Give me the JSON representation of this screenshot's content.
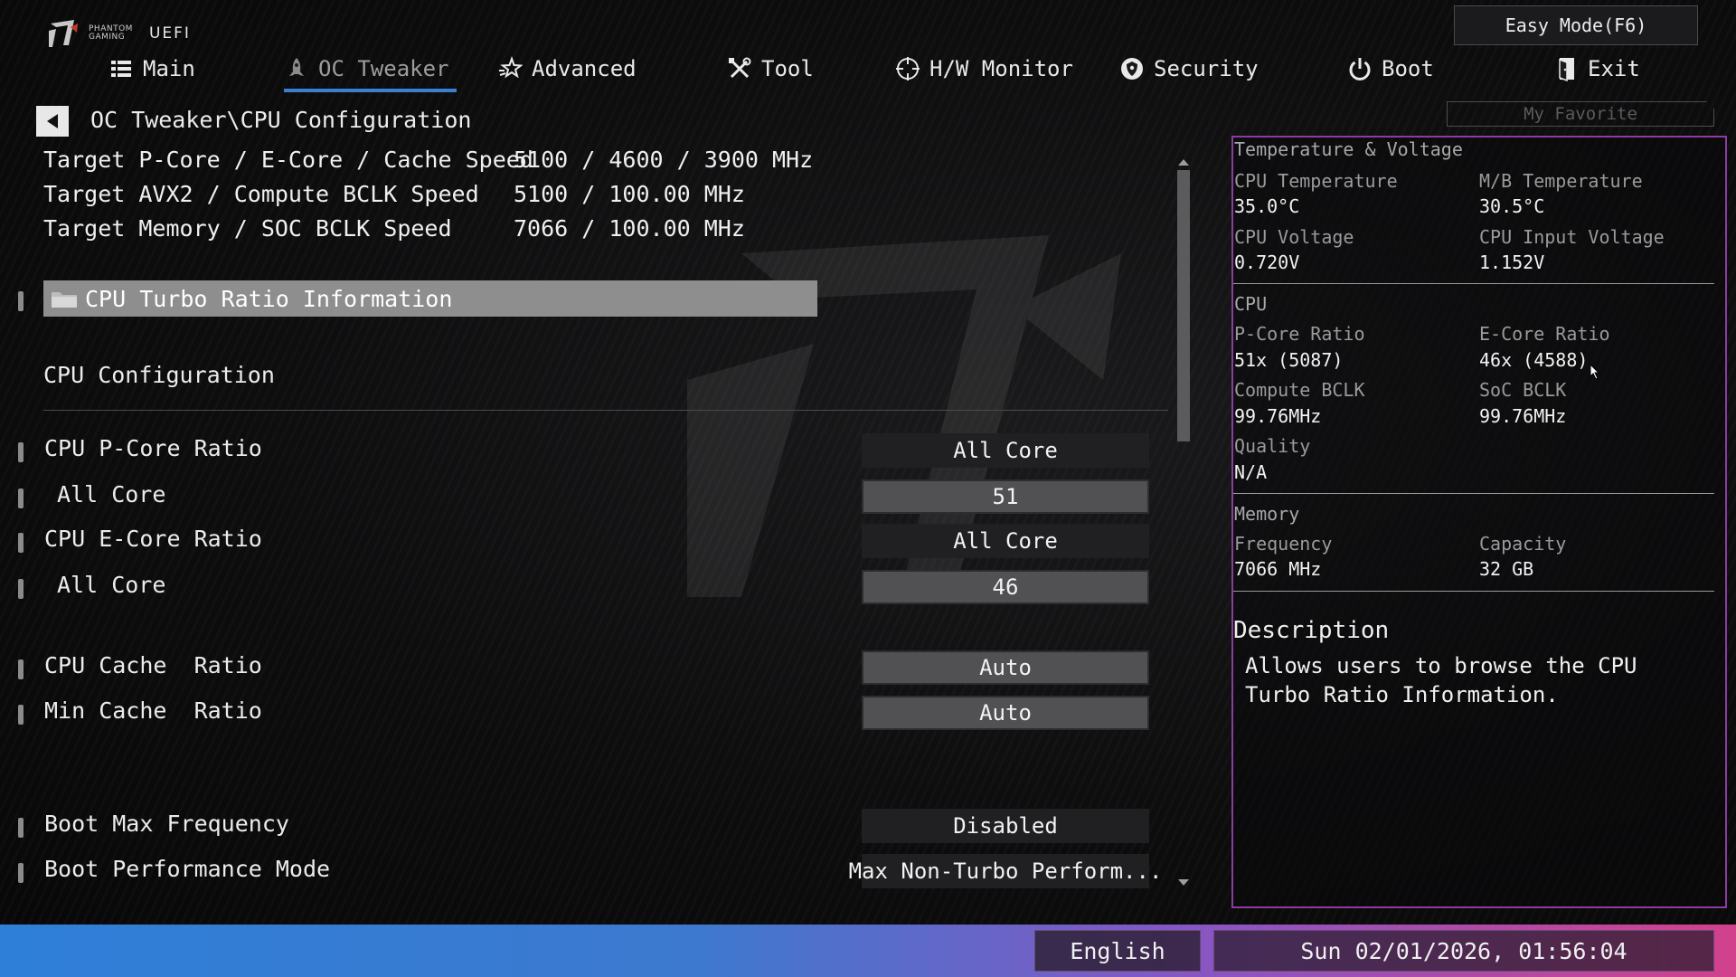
{
  "brand": {
    "line1": "PHANTOM",
    "line2": "GAMING",
    "uefi": "UEFI"
  },
  "header": {
    "easy_mode": "Easy Mode(F6)",
    "my_favorite": "My Favorite"
  },
  "nav": [
    {
      "label": "Main",
      "icon": "list-icon"
    },
    {
      "label": "OC Tweaker",
      "icon": "rocket-icon",
      "active": true
    },
    {
      "label": "Advanced",
      "icon": "star-icon"
    },
    {
      "label": "Tool",
      "icon": "tools-icon"
    },
    {
      "label": "H/W Monitor",
      "icon": "crosshair-icon"
    },
    {
      "label": "Security",
      "icon": "shield-icon"
    },
    {
      "label": "Boot",
      "icon": "power-icon"
    },
    {
      "label": "Exit",
      "icon": "exit-door-icon"
    }
  ],
  "breadcrumb": "OC Tweaker\\CPU Configuration",
  "info": [
    {
      "label": "Target P-Core / E-Core / Cache Speed",
      "value": "5100 / 4600 / 3900 MHz"
    },
    {
      "label": "Target AVX2 / Compute BCLK Speed",
      "value": "5100 / 100.00 MHz"
    },
    {
      "label": "Target Memory / SOC BCLK Speed",
      "value": "7066 / 100.00 MHz"
    }
  ],
  "turbo_info": "CPU Turbo Ratio Information",
  "section_title": "CPU Configuration",
  "settings": [
    {
      "label": "CPU P-Core Ratio",
      "value": "All Core"
    },
    {
      "label": "All Core",
      "value": "51"
    },
    {
      "label": "CPU E-Core Ratio",
      "value": "All Core"
    },
    {
      "label": "All Core",
      "value": "46"
    },
    {
      "label": "CPU Cache  Ratio",
      "value": "Auto"
    },
    {
      "label": "Min Cache  Ratio",
      "value": "Auto"
    },
    {
      "label": "Boot Max Frequency",
      "value": "Disabled"
    },
    {
      "label": "Boot Performance Mode",
      "value": "Max Non-Turbo Perform..."
    }
  ],
  "monitor": {
    "temp_voltage_title": "Temperature & Voltage",
    "cpu_temp_label": "CPU Temperature",
    "cpu_temp": "35.0°C",
    "mb_temp_label": "M/B Temperature",
    "mb_temp": "30.5°C",
    "cpu_voltage_label": "CPU Voltage",
    "cpu_voltage": "0.720V",
    "cpu_input_voltage_label": "CPU Input Voltage",
    "cpu_input_voltage": "1.152V",
    "cpu_title": "CPU",
    "pcore_ratio_label": "P-Core Ratio",
    "pcore_ratio": "51x (5087)",
    "ecore_ratio_label": "E-Core Ratio",
    "ecore_ratio": "46x (4588)",
    "compute_bclk_label": "Compute BCLK",
    "compute_bclk": "99.76MHz",
    "soc_bclk_label": "SoC BCLK",
    "soc_bclk": "99.76MHz",
    "quality_label": "Quality",
    "quality": "N/A",
    "memory_title": "Memory",
    "frequency_label": "Frequency",
    "frequency": "7066 MHz",
    "capacity_label": "Capacity",
    "capacity": "32 GB"
  },
  "description": {
    "title": "Description",
    "text": "Allows users to browse the CPU Turbo Ratio Information."
  },
  "footer": {
    "language": "English",
    "datetime": "Sun 02/01/2026, 01:56:04"
  },
  "colors": {
    "accent": "#3b7fd0",
    "panel_border": "#8b3c9f",
    "footer_start": "#2e7fd8",
    "footer_end": "#d2418c"
  }
}
